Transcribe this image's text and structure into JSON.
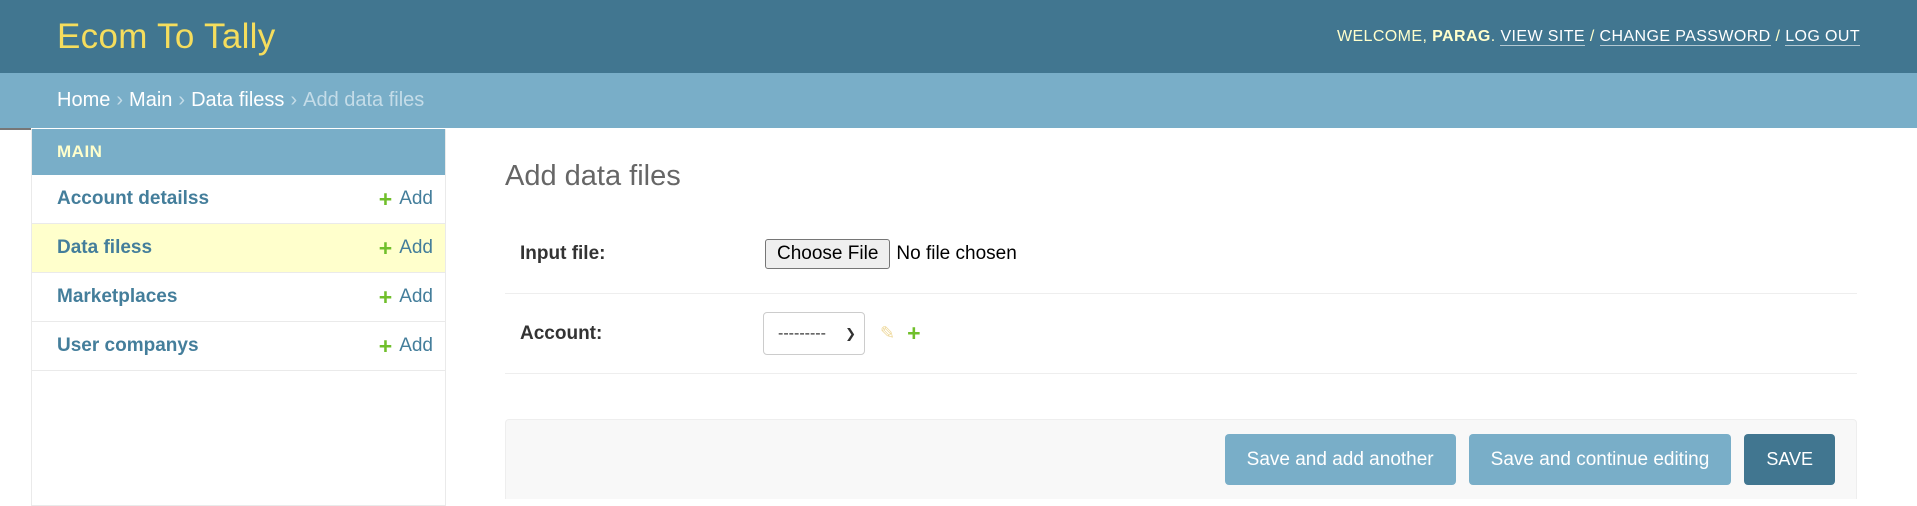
{
  "header": {
    "site_name": "Ecom To Tally",
    "welcome": "Welcome,",
    "username": "Parag",
    "period": ".",
    "view_site": "View site",
    "separator": "/",
    "change_password": "Change password",
    "log_out": "Log out"
  },
  "breadcrumbs": {
    "items": [
      "Home",
      "Main",
      "Data filess"
    ],
    "current": "Add data files",
    "separator": "›"
  },
  "sidebar": {
    "module_caption": "Main",
    "items": [
      {
        "label": "Account detailss",
        "add_label": "Add",
        "current": false
      },
      {
        "label": "Data filess",
        "add_label": "Add",
        "current": true
      },
      {
        "label": "Marketplaces",
        "add_label": "Add",
        "current": false
      },
      {
        "label": "User companys",
        "add_label": "Add",
        "current": false
      }
    ]
  },
  "content": {
    "title": "Add data files",
    "fields": {
      "input_file": {
        "label": "Input file:",
        "button_label": "Choose File",
        "status": "No file chosen"
      },
      "account": {
        "label": "Account:",
        "selected": "---------",
        "edit_icon": "pencil-icon",
        "add_icon": "plus-icon"
      }
    },
    "submit_row": {
      "save_add_another": "Save and add another",
      "save_continue": "Save and continue editing",
      "save": "Save"
    }
  },
  "colors": {
    "header_bg": "#417690",
    "breadcrumb_bg": "#79aec8",
    "brand_text": "#f5dd5d",
    "link": "#447e9b",
    "add_green": "#70bf2b",
    "current_row_bg": "#ffffcc"
  }
}
